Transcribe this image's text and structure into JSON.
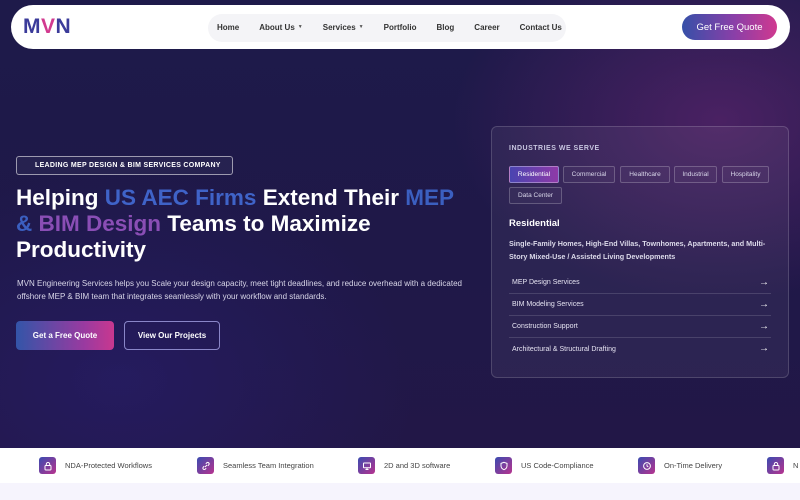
{
  "nav": {
    "logo": {
      "m": "M",
      "v": "V",
      "n": "N"
    },
    "items": [
      {
        "label": "Home",
        "caret": false
      },
      {
        "label": "About Us",
        "caret": true
      },
      {
        "label": "Services",
        "caret": true
      },
      {
        "label": "Portfolio",
        "caret": false
      },
      {
        "label": "Blog",
        "caret": false
      },
      {
        "label": "Career",
        "caret": false
      },
      {
        "label": "Contact Us",
        "caret": false
      }
    ],
    "cta": "Get Free Quote"
  },
  "hero": {
    "badge": "LEADING MEP DESIGN & BIM SERVICES COMPANY",
    "headline": {
      "p1": "Helping ",
      "p2": "US AEC Firms",
      "p3": " Extend Their ",
      "p4": "MEP",
      "p5": " & ",
      "p6": "BIM Design",
      "p7": " Teams to Maximize Productivity"
    },
    "description": "MVN Engineering Services helps you Scale your design capacity, meet tight deadlines, and reduce overhead with a dedicated offshore MEP & BIM team that integrates seamlessly with your workflow and standards.",
    "primary_button": "Get a Free Quote",
    "secondary_button": "View Our Projects"
  },
  "industries": {
    "title": "INDUSTRIES WE SERVE",
    "chips": [
      "Residential",
      "Commercial",
      "Healthcare",
      "Industrial",
      "Hospitality",
      "Data Center"
    ],
    "active_chip": "Residential",
    "selected_title": "Residential",
    "selected_desc": "Single-Family Homes, High-End Villas, Townhomes, Apartments, and Multi-Story Mixed-Use / Assisted Living Developments",
    "services": [
      "MEP Design Services",
      "BIM Modeling Services",
      "Construction Support",
      "Architectural & Structural Drafting"
    ],
    "arrow": "→"
  },
  "features": [
    {
      "label": "NDA-Protected Workflows",
      "icon": "lock-icon"
    },
    {
      "label": "Seamless Team Integration",
      "icon": "link-icon"
    },
    {
      "label": "2D and 3D software",
      "icon": "monitor-icon"
    },
    {
      "label": "US Code-Compliance",
      "icon": "shield-icon"
    },
    {
      "label": "On-Time Delivery",
      "icon": "clock-icon"
    },
    {
      "label": "N",
      "icon": "lock-icon"
    }
  ],
  "colors": {
    "brand_blue": "#3b3b9a",
    "brand_pink": "#d23a8f",
    "hero_bg": "#1e1a4a"
  }
}
